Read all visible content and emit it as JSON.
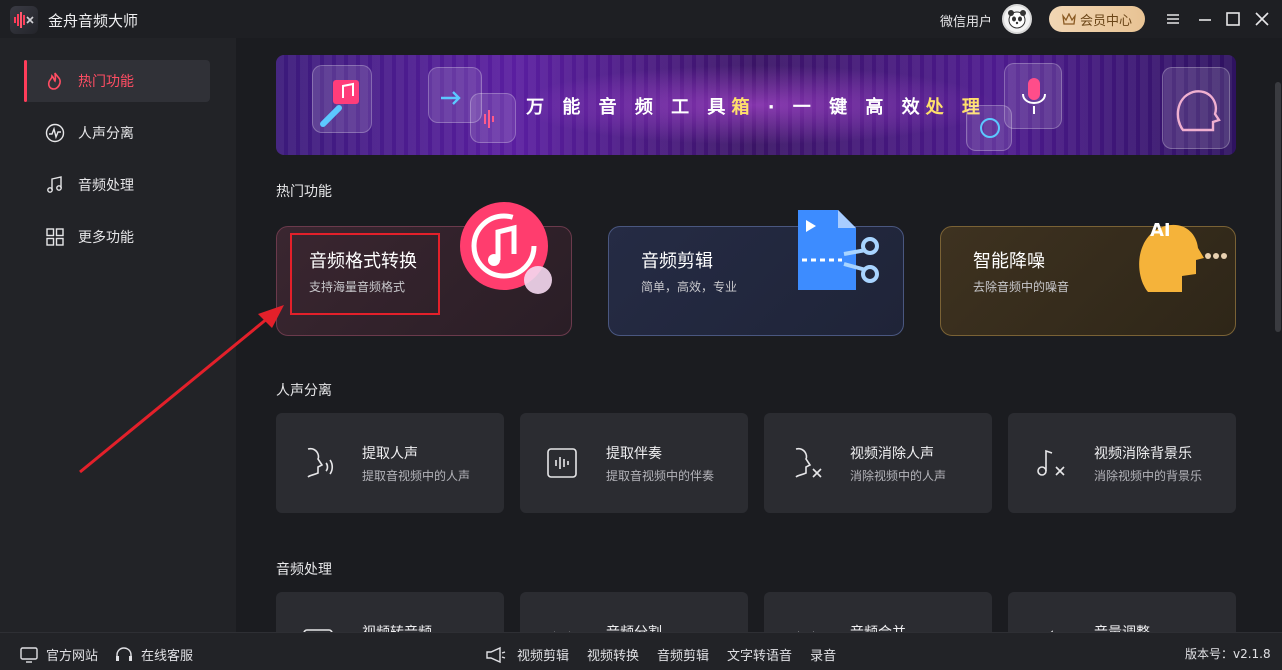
{
  "app": {
    "title": "金舟音频大师"
  },
  "header": {
    "user_name": "微信用户",
    "vip_label": "会员中心"
  },
  "sidebar": {
    "items": [
      {
        "label": "热门功能",
        "active": true
      },
      {
        "label": "人声分离"
      },
      {
        "label": "音频处理"
      },
      {
        "label": "更多功能"
      }
    ]
  },
  "banner": {
    "text_a": "万 能 音 频 工 具",
    "text_hl": "箱",
    "text_b": " · 一 键 高 效",
    "text_hl2": "处 理"
  },
  "sections": {
    "hot": {
      "title": "热门功能",
      "cards": [
        {
          "title": "音频格式转换",
          "subtitle": "支持海量音频格式"
        },
        {
          "title": "音频剪辑",
          "subtitle": "简单，高效，专业"
        },
        {
          "title": "智能降噪",
          "subtitle": "去除音频中的噪音"
        }
      ]
    },
    "vocal": {
      "title": "人声分离",
      "cards": [
        {
          "title": "提取人声",
          "subtitle": "提取音视频中的人声"
        },
        {
          "title": "提取伴奏",
          "subtitle": "提取音视频中的伴奏"
        },
        {
          "title": "视频消除人声",
          "subtitle": "消除视频中的人声"
        },
        {
          "title": "视频消除背景乐",
          "subtitle": "消除视频中的背景乐"
        }
      ]
    },
    "audio": {
      "title": "音频处理",
      "cards": [
        {
          "title": "视频转音频"
        },
        {
          "title": "音频分割"
        },
        {
          "title": "音频合并"
        },
        {
          "title": "音量调整"
        }
      ]
    }
  },
  "footer": {
    "website": "官方网站",
    "support": "在线客服",
    "links": [
      "视频剪辑",
      "视频转换",
      "音频剪辑",
      "文字转语音",
      "录音"
    ],
    "version": "版本号：v2.1.8"
  },
  "colors": {
    "accent": "#ff3d5a",
    "highlight_box": "#e3202a"
  }
}
